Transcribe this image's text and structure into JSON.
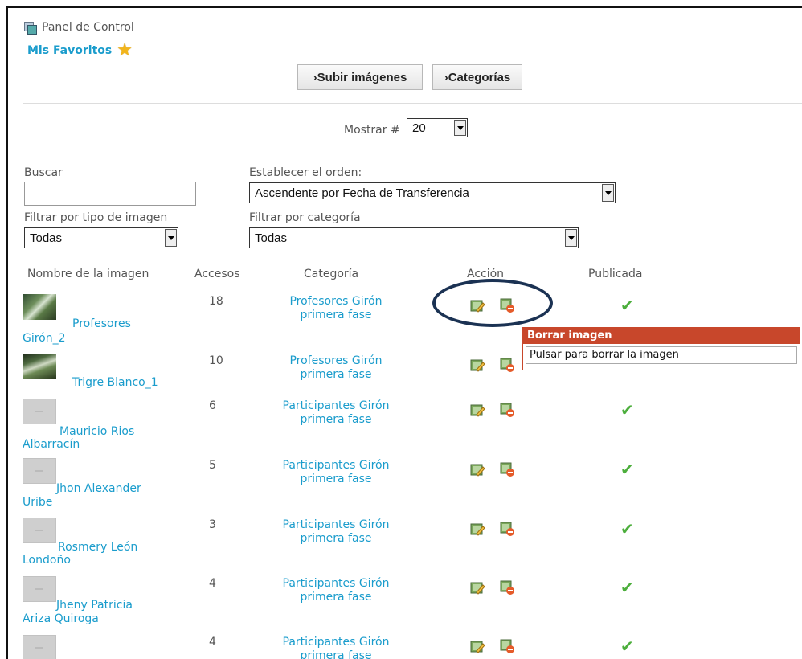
{
  "header": {
    "panel_label": "Panel de Control",
    "favoritos_label": "Mis Favoritos"
  },
  "toolbar": {
    "upload_label": "›Subir imágenes",
    "categories_label": "›Categorías"
  },
  "pagination": {
    "mostrar_label": "Mostrar #",
    "mostrar_value": "20"
  },
  "filters": {
    "buscar_label": "Buscar",
    "buscar_value": "",
    "orden_label": "Establecer el orden:",
    "orden_value": "Ascendente por Fecha de Transferencia",
    "tipo_label": "Filtrar por tipo de imagen",
    "tipo_value": "Todas",
    "categoria_label": "Filtrar por categoría",
    "categoria_value": "Todas"
  },
  "table": {
    "headers": {
      "nombre": "Nombre de la imagen",
      "accesos": "Accesos",
      "categoria": "Categoría",
      "accion": "Acción",
      "publicada": "Publicada"
    },
    "rows": [
      {
        "name_line1": "Profesores",
        "name_line2": "Girón_2",
        "accesos": "18",
        "cat_line1": "Profesores Girón",
        "cat_line2": "primera fase",
        "published": true
      },
      {
        "name_line1": "Trigre Blanco_1",
        "name_line2": "",
        "accesos": "10",
        "cat_line1": "Profesores Girón",
        "cat_line2": "primera fase",
        "published": false
      },
      {
        "name_line1": "Mauricio Rios",
        "name_line2": "Albarracín",
        "accesos": "6",
        "cat_line1": "Participantes Girón",
        "cat_line2": "primera fase",
        "published": true
      },
      {
        "name_line1": "Jhon Alexander",
        "name_line2": "Uribe",
        "accesos": "5",
        "cat_line1": "Participantes Girón",
        "cat_line2": "primera fase",
        "published": true
      },
      {
        "name_line1": "Rosmery León",
        "name_line2": "Londoño",
        "accesos": "3",
        "cat_line1": "Participantes Girón",
        "cat_line2": "primera fase",
        "published": true
      },
      {
        "name_line1": "Jheny Patricia",
        "name_line2": "Ariza Quiroga",
        "accesos": "4",
        "cat_line1": "Participantes Girón",
        "cat_line2": "primera fase",
        "published": true
      },
      {
        "name_line1": "",
        "name_line2": "",
        "accesos": "4",
        "cat_line1": "Participantes Girón",
        "cat_line2": "primera fase",
        "published": true
      }
    ]
  },
  "tooltip": {
    "title": "Borrar imagen",
    "body": "Pulsar para borrar la imagen"
  },
  "icons": {
    "panel": "panel-control-icon",
    "star": "star-icon",
    "edit": "edit-image-icon",
    "delete": "delete-image-icon",
    "check": "check-icon"
  },
  "colors": {
    "link": "#1a9ccc",
    "tooltip": "#c8472b",
    "check": "#4cae3c",
    "annotation": "#1b3253"
  }
}
